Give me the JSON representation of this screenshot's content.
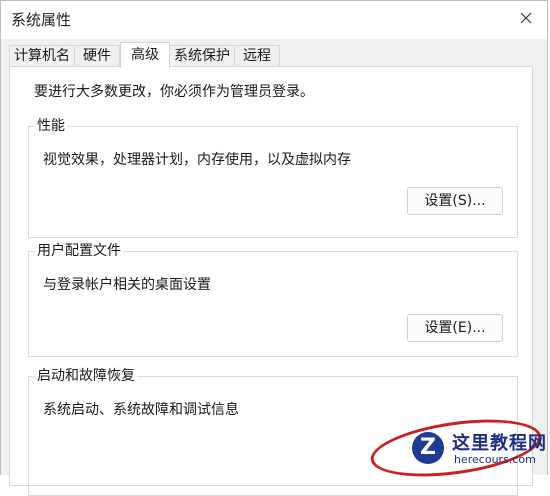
{
  "window": {
    "title": "系统属性"
  },
  "tabs": [
    {
      "label": "计算机名"
    },
    {
      "label": "硬件"
    },
    {
      "label": "高级",
      "active": true
    },
    {
      "label": "系统保护"
    },
    {
      "label": "远程"
    }
  ],
  "panel": {
    "admin_note": "要进行大多数更改，你必须作为管理员登录。",
    "performance": {
      "title": "性能",
      "description": "视觉效果，处理器计划，内存使用，以及虚拟内存",
      "button": "设置(S)..."
    },
    "user_profiles": {
      "title": "用户配置文件",
      "description": "与登录帐户相关的桌面设置",
      "button": "设置(E)..."
    },
    "startup_recovery": {
      "title": "启动和故障恢复",
      "description": "系统启动、系统故障和调试信息"
    }
  },
  "watermark": {
    "logo": "Z",
    "text_cn": "这里教程网",
    "text_en": "herecours.com"
  },
  "colors": {
    "accent_circle": "#d01e1e",
    "watermark_blue": "#1f3c93",
    "panel_bg": "#ffffff",
    "window_bg": "#f0f0f0"
  },
  "icons": {
    "close": "close-icon"
  }
}
